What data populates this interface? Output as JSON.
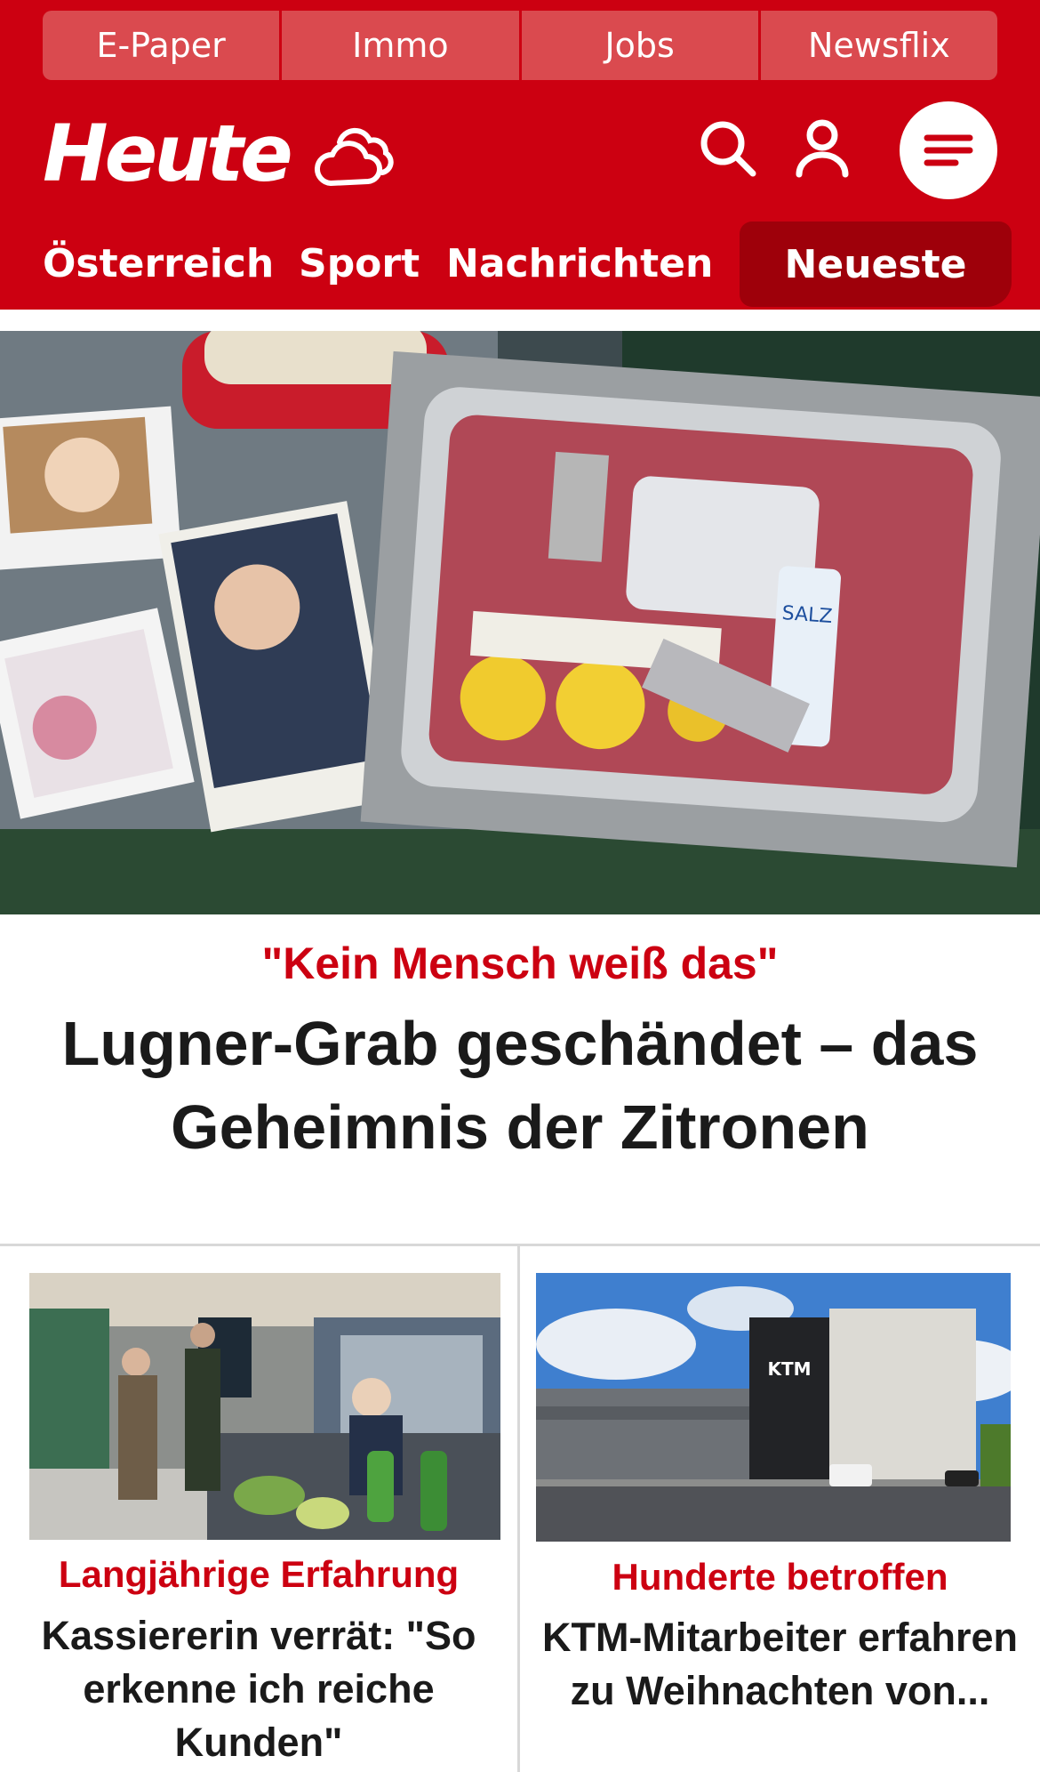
{
  "topbar": {
    "tabs": [
      "E-Paper",
      "Immo",
      "Jobs",
      "Newsflix"
    ]
  },
  "brand": {
    "logo": "Heute",
    "color": "#cc0011"
  },
  "icons": {
    "weather": "weather-icon",
    "search": "search-icon",
    "account": "user-icon",
    "menu": "menu-icon"
  },
  "nav": {
    "items": [
      "Österreich",
      "Sport",
      "Nachrichten"
    ],
    "active": "Neueste"
  },
  "hero": {
    "kicker": "\"Kein Mensch weiß das\"",
    "headline": "Lugner-Grab geschändet – das Geheimnis der Zitronen"
  },
  "articles": [
    {
      "kicker": "Langjährige Erfahrung",
      "headline": "Kassiererin verrät: \"So erkenne ich reiche Kunden\""
    },
    {
      "kicker": "Hunderte betroffen",
      "headline": "KTM-Mitarbeiter erfahren zu Weihnachten von..."
    }
  ],
  "photo_text": {
    "salt_label": "SALZ",
    "building_sign": "KTM"
  }
}
